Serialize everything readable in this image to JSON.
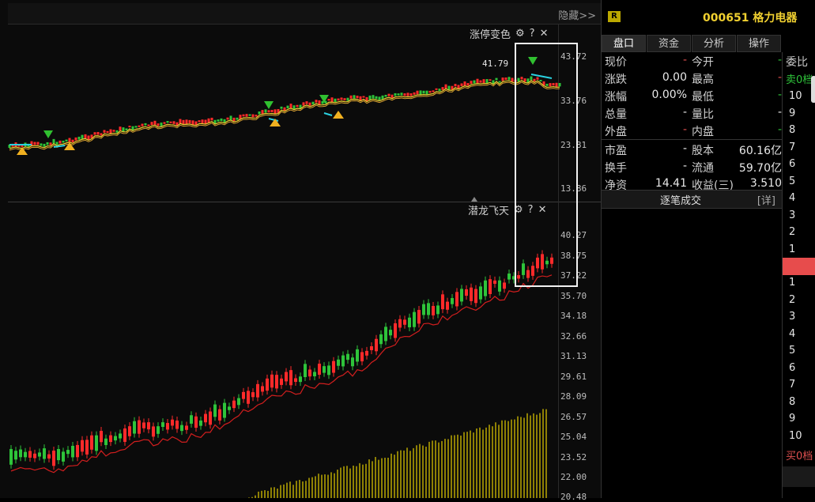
{
  "toolbar": {
    "hide_label": "隐藏>>"
  },
  "upper_panel": {
    "title": "涨停变色",
    "axis_ticks": [
      "43.72",
      "33.76",
      "23.81",
      "13.86"
    ],
    "price_note": "41.79"
  },
  "lower_panel": {
    "title": "潜龙飞天",
    "axis_ticks": [
      "40.27",
      "38.75",
      "37.22",
      "35.70",
      "34.18",
      "32.66",
      "31.13",
      "29.61",
      "28.09",
      "26.57",
      "25.04",
      "23.52",
      "22.00",
      "20.48"
    ]
  },
  "icons": {
    "settings": "gear-icon",
    "help": "question-icon",
    "close": "close-icon"
  },
  "colors": {
    "up": "#ff2a2a",
    "down": "#2ec43a",
    "ma": "#f0d030",
    "accent": "#e74c4c",
    "cyan": "#2ad1e0"
  },
  "stock": {
    "badge": "R",
    "code_name": "000651 格力电器"
  },
  "tabs": [
    "盘口",
    "资金",
    "分析",
    "操作"
  ],
  "quote": [
    {
      "k1": "现价",
      "v1": "-",
      "k2": "今开",
      "v2": "-"
    },
    {
      "k1": "涨跌",
      "v1": "0.00",
      "k2": "最高",
      "v2": "-"
    },
    {
      "k1": "涨幅",
      "v1": "0.00%",
      "k2": "最低",
      "v2": "-"
    },
    {
      "k1": "总量",
      "v1": "-",
      "k2": "量比",
      "v2": "-"
    },
    {
      "k1": "外盘",
      "v1": "-",
      "k2": "内盘",
      "v2": "-"
    },
    {
      "k1": "市盈",
      "v1": "-",
      "k2": "股本",
      "v2": "60.16亿"
    },
    {
      "k1": "换手",
      "v1": "-",
      "k2": "流通",
      "v2": "59.70亿"
    },
    {
      "k1": "净资",
      "v1": "14.41",
      "k2": "收益(三)",
      "v2": "3.510"
    }
  ],
  "tick_button": {
    "label": "逐笔成交",
    "detail": "[详]"
  },
  "order_book": {
    "header": "委比",
    "sell_label": "卖0档",
    "buy_label": "买0档",
    "sell_levels": [
      "10",
      "9",
      "8",
      "7",
      "6",
      "5",
      "4",
      "3",
      "2",
      "1"
    ],
    "buy_levels": [
      "1",
      "2",
      "3",
      "4",
      "5",
      "6",
      "7",
      "8",
      "9",
      "10"
    ]
  }
}
